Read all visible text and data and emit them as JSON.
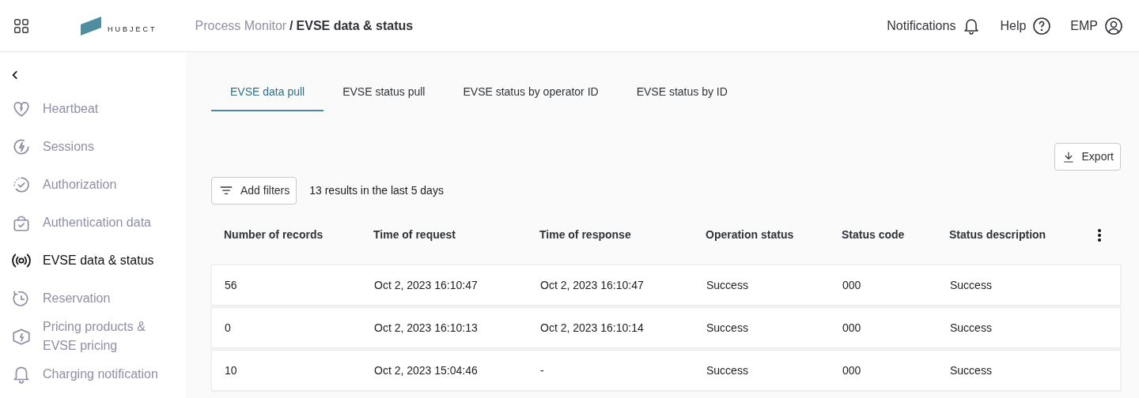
{
  "header": {
    "logo_text": "HUBJECT",
    "breadcrumb": [
      {
        "label": "Process Monitor",
        "current": false
      },
      {
        "label": "EVSE data & status",
        "current": true
      }
    ],
    "separator": "/",
    "actions": [
      {
        "label": "Notifications",
        "kind": "bell"
      },
      {
        "label": "Help",
        "kind": "help"
      },
      {
        "label": "EMP",
        "kind": "user"
      }
    ]
  },
  "sidebar": {
    "items": [
      {
        "label": "Heartbeat",
        "selected": false
      },
      {
        "label": "Sessions",
        "selected": false
      },
      {
        "label": "Authorization",
        "selected": false
      },
      {
        "label": "Authentication data",
        "selected": false
      },
      {
        "label": "EVSE data & status",
        "selected": true
      },
      {
        "label": "Reservation",
        "selected": false
      },
      {
        "label": "Pricing products & EVSE pricing",
        "selected": false
      },
      {
        "label": "Charging notification",
        "selected": false
      }
    ]
  },
  "tabs": [
    {
      "label": "EVSE data pull",
      "selected": true
    },
    {
      "label": "EVSE status pull",
      "selected": false
    },
    {
      "label": "EVSE status by operator ID",
      "selected": false
    },
    {
      "label": "EVSE status by ID",
      "selected": false
    }
  ],
  "export_button": "Export",
  "filter_button": "Add filters",
  "result_count": "13 results in the last 5 days",
  "table": {
    "columns": [
      "Number of records",
      "Time of request",
      "Time of response",
      "Operation status",
      "Status code",
      "Status description"
    ],
    "rows": [
      [
        "56",
        "Oct 2, 2023 16:10:47",
        "Oct 2, 2023 16:10:47",
        "Success",
        "000",
        "Success"
      ],
      [
        "0",
        "Oct 2, 2023 16:10:13",
        "Oct 2, 2023 16:10:14",
        "Success",
        "000",
        "Success"
      ],
      [
        "10",
        "Oct 2, 2023 15:04:46",
        "-",
        "Success",
        "000",
        "Success"
      ]
    ]
  }
}
